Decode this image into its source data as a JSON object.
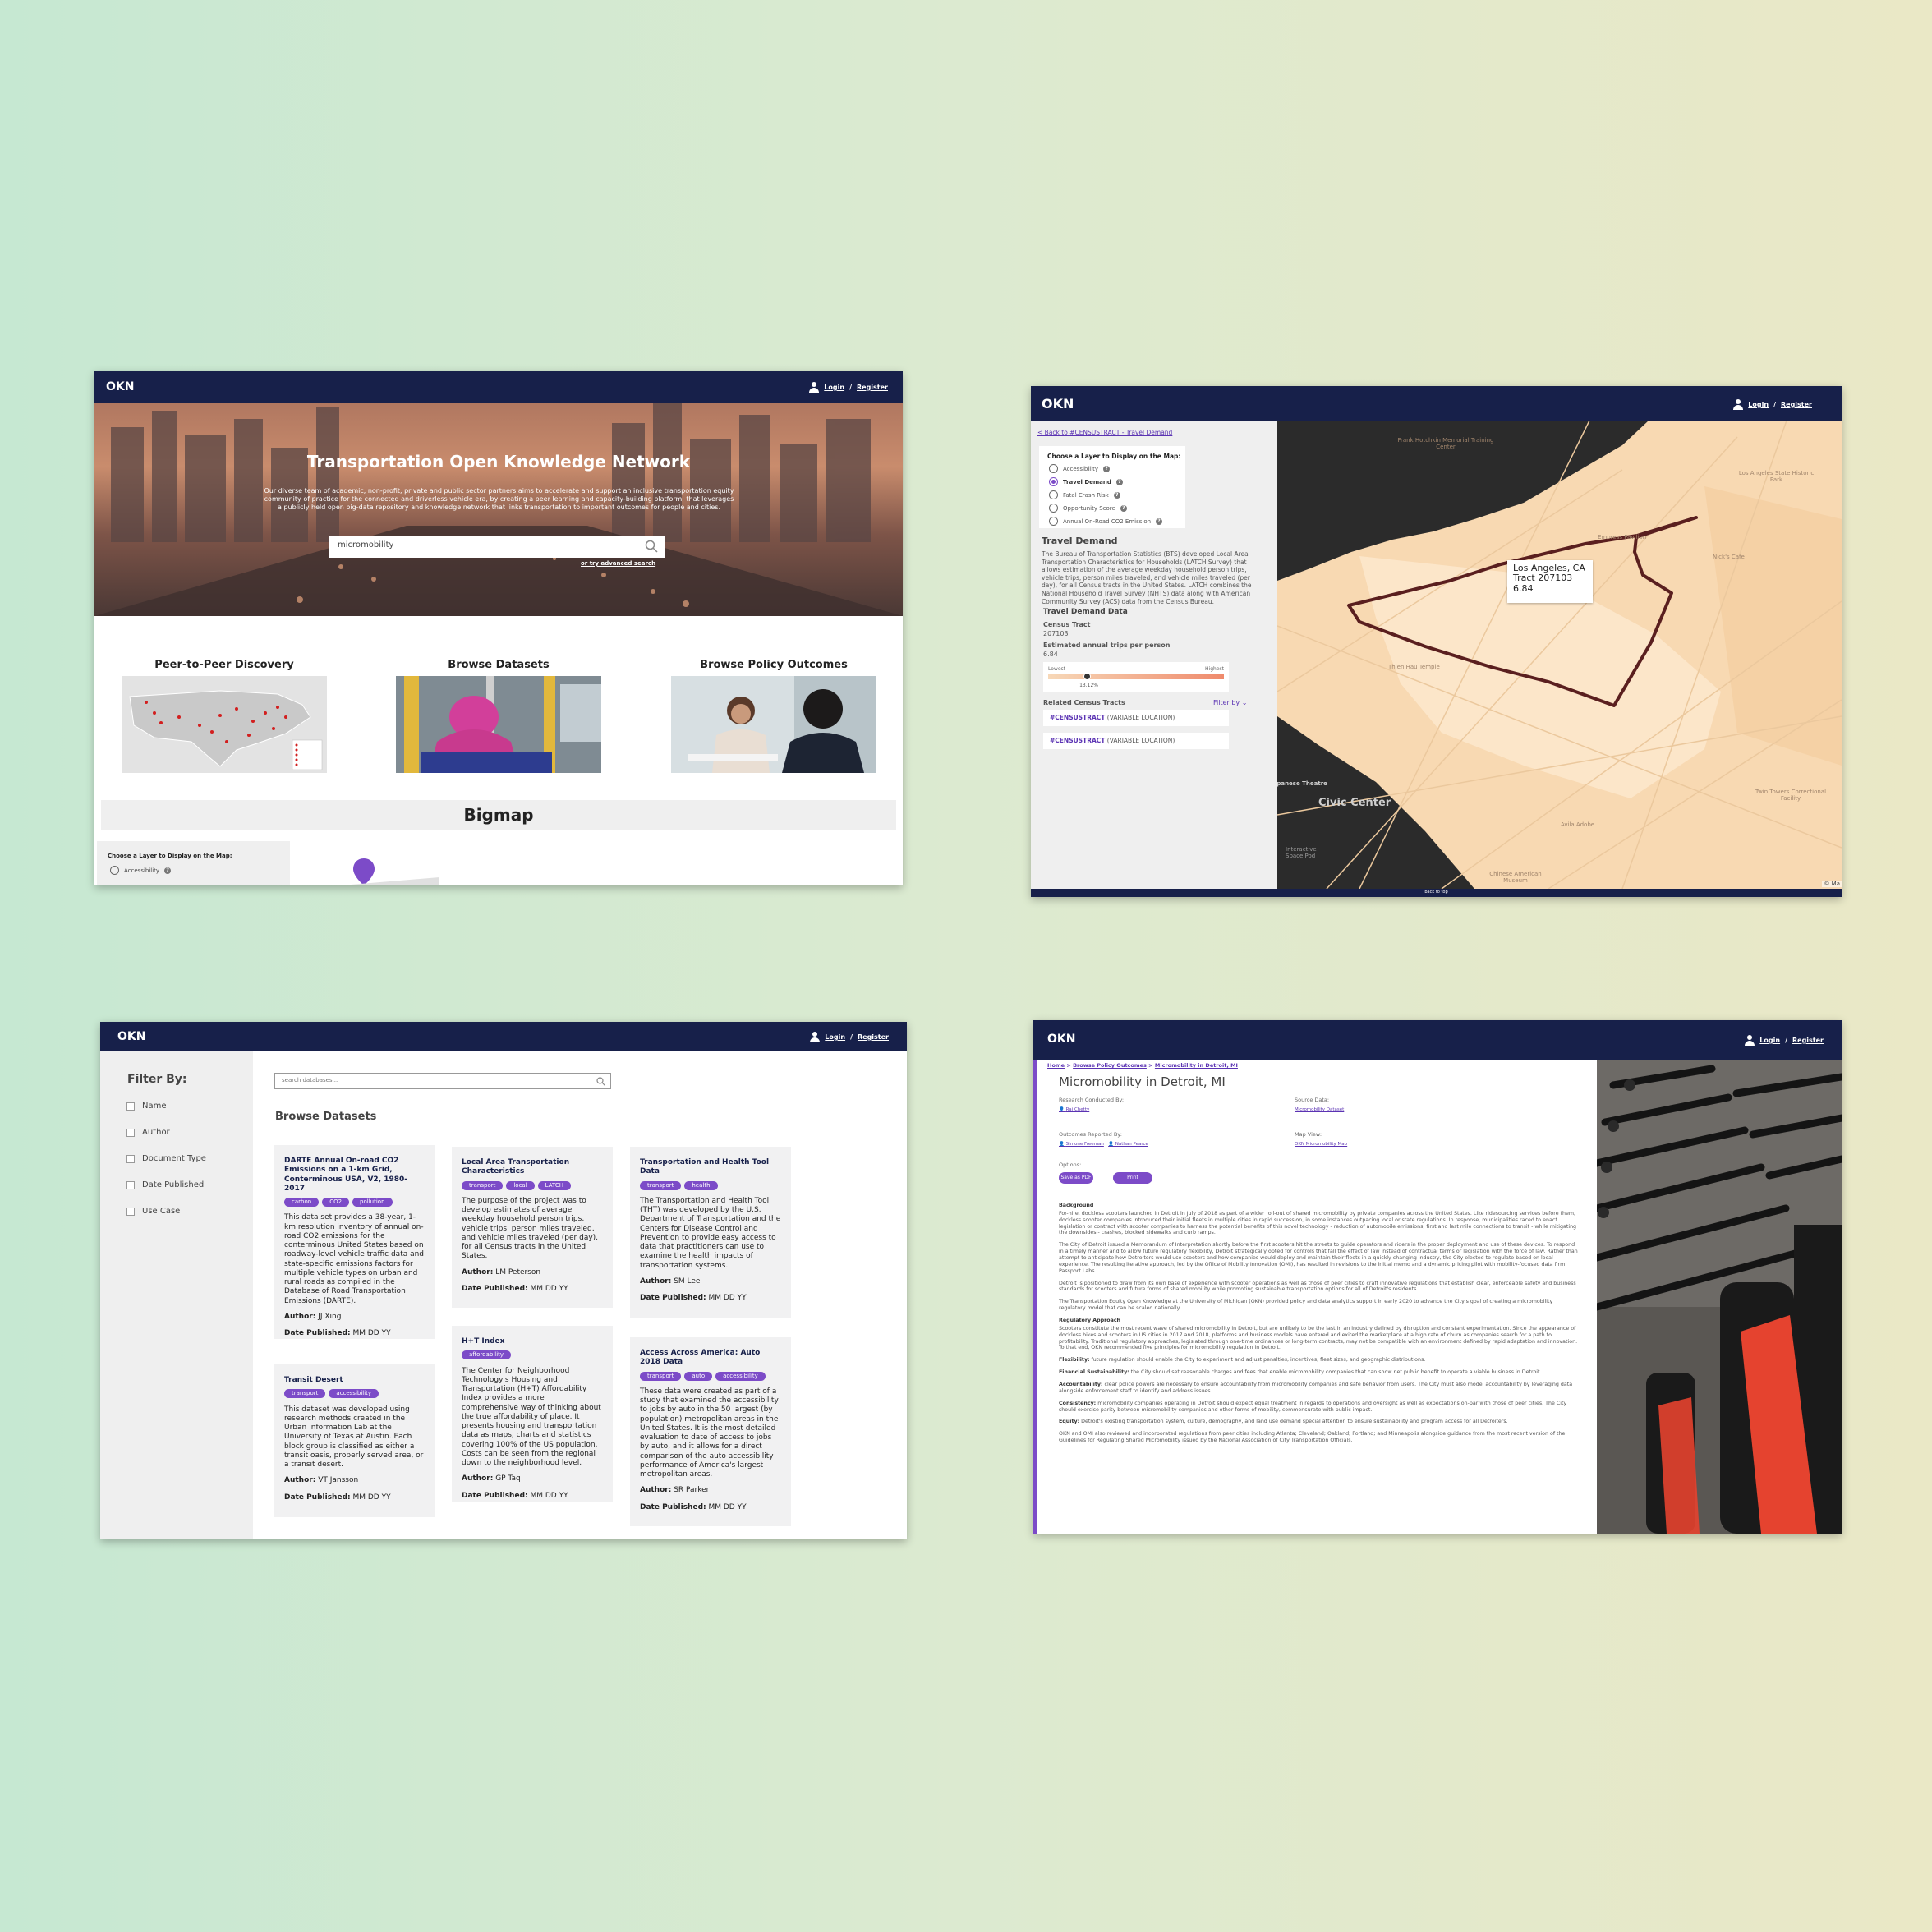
{
  "home": {
    "logo": "OKN",
    "login": "Login",
    "register": "Register",
    "hero_title": "Transportation Open Knowledge Network",
    "hero_text": "Our diverse team of academic, non-profit, private and public sector partners aims to accelerate and support an inclusive transportation equity community of practice for the connected and driverless vehicle era, by creating a peer learning and capacity-building platform, that leverages a publicly held open big-data repository and knowledge network that links transportation to important outcomes for people and cities.",
    "search_value": "micromobility",
    "advanced_search": "or try advanced search",
    "tiles": [
      "Peer-to-Peer Discovery",
      "Browse Datasets",
      "Browse Policy Outcomes"
    ],
    "bigmap_title": "Bigmap",
    "layer_prompt": "Choose a Layer to Display on the Map:",
    "layer_first": "Accessibility"
  },
  "mapview": {
    "logo": "OKN",
    "login": "Login",
    "register": "Register",
    "back_link": "< Back to #CENSUSTRACT - Travel Demand",
    "layer_prompt": "Choose a Layer to Display on the Map:",
    "layers": [
      {
        "label": "Accessibility",
        "selected": false
      },
      {
        "label": "Travel Demand",
        "selected": true
      },
      {
        "label": "Fatal Crash Risk",
        "selected": false
      },
      {
        "label": "Opportunity Score",
        "selected": false
      },
      {
        "label": "Annual On-Road CO2 Emission",
        "selected": false
      }
    ],
    "section_title": "Travel Demand",
    "section_text": "The Bureau of Transportation Statistics (BTS) developed Local Area Transportation Characteristics for Households (LATCH Survey) that allows estimation of the average weekday household person trips, vehicle trips, person miles traveled, and vehicle miles traveled (per day), for all Census tracts in the United States. LATCH combines the National Household Travel Survey (NHTS) data along with American Community Survey (ACS) data from the Census Bureau.",
    "data_title": "Travel Demand Data",
    "census_tract_label": "Census Tract",
    "census_tract_value": "207103",
    "trips_label": "Estimated annual trips per person",
    "trips_value": "6.84",
    "scale_low": "Lowest",
    "scale_high": "Highest",
    "scale_marker": "13.12%",
    "scale_fraction": 0.22,
    "related_title": "Related Census Tracts",
    "filter_by": "Filter by",
    "related": [
      {
        "tag": "#CENSUSTRACT",
        "loc": "(VARIABLE LOCATION)"
      },
      {
        "tag": "#CENSUSTRACT",
        "loc": "(VARIABLE LOCATION)"
      }
    ],
    "tooltip": [
      "Los Angeles, CA",
      "Tract 207103",
      "6.84"
    ],
    "map_labels": [
      "Frank Hotchkin Memorial Training Center",
      "Los Angeles State Historic Park",
      "Empress Pavilion",
      "Nick's Cafe",
      "Thien Hau Temple",
      "Civic Center",
      "Twin Towers Correctional Facility",
      "Avila Adobe",
      "Chinese American Museum",
      "Interactive Space Pod",
      "Japanese Theatre"
    ],
    "map_credit": "© Ma",
    "back_to_top": "back to top"
  },
  "datasets": {
    "logo": "OKN",
    "login": "Login",
    "register": "Register",
    "filter_title": "Filter By:",
    "filters": [
      "Name",
      "Author",
      "Document Type",
      "Date Published",
      "Use Case"
    ],
    "search_placeholder": "search databases...",
    "page_title": "Browse Datasets",
    "author_label": "Author:",
    "date_label": "Date Published:",
    "cards": [
      {
        "title": "DARTE Annual On-road CO2 Emissions on a 1-km Grid, Conterminous USA, V2, 1980-2017",
        "tags": [
          "carbon",
          "CO2",
          "pollution"
        ],
        "desc": "This data set provides a 38-year, 1-km resolution inventory of annual on-road CO2 emissions for the conterminous United States based on roadway-level vehicle traffic data and state-specific emissions factors for multiple vehicle types on urban and rural roads as compiled in the Database of Road Transportation Emissions (DARTE).",
        "author": "JJ Xing",
        "date": "MM DD YY"
      },
      {
        "title": "Local Area Transportation Characteristics",
        "tags": [
          "transport",
          "local",
          "LATCH"
        ],
        "desc": "The purpose of the project was to develop estimates of average weekday household person trips, vehicle trips, person miles traveled, and vehicle miles traveled (per day), for all Census tracts in the United States.",
        "author": "LM Peterson",
        "date": "MM DD YY"
      },
      {
        "title": "Transportation and Health Tool Data",
        "tags": [
          "transport",
          "health"
        ],
        "desc": "The Transportation and Health Tool (THT) was developed by the U.S. Department of Transportation and the Centers for Disease Control and Prevention to provide easy access to data that practitioners can use to examine the health impacts of transportation systems.",
        "author": "SM Lee",
        "date": "MM DD YY"
      },
      {
        "title": "Transit Desert",
        "tags": [
          "transport",
          "accessibility"
        ],
        "desc": "This dataset was developed using research methods created in the Urban Information Lab at the University of Texas at Austin. Each block group is classified as either a transit oasis, properly served area, or a transit desert.",
        "author": "VT Jansson",
        "date": "MM DD YY"
      },
      {
        "title": "H+T Index",
        "tags": [
          "affordability"
        ],
        "desc": "The Center for Neighborhood Technology's Housing and Transportation (H+T) Affordability Index provides a more comprehensive way of thinking about the true affordability of place. It presents housing and transportation data as maps, charts and statistics covering 100% of the US population. Costs can be seen from the regional down to the neighborhood level.",
        "author": "GP Taq",
        "date": "MM DD YY"
      },
      {
        "title": "Access Across America: Auto 2018 Data",
        "tags": [
          "transport",
          "auto",
          "accessibility"
        ],
        "desc": "These data were created as part of a study that examined the accessibility to jobs by auto in the 50 largest (by population) metropolitan areas in the United States. It is the most detailed evaluation to date of access to jobs by auto, and it allows for a direct comparison of the auto accessibility performance of America's largest metropolitan areas.",
        "author": "SR Parker",
        "date": "MM DD YY"
      }
    ]
  },
  "policy": {
    "logo": "OKN",
    "login": "Login",
    "register": "Register",
    "breadcrumb": [
      "Home",
      "Browse Policy Outcomes",
      "Micromobility in Detroit, MI"
    ],
    "title": "Micromobility in Detroit, MI",
    "research_label": "Research Conducted By:",
    "research_person": "Raj Chetty",
    "source_label": "Source Data:",
    "source_value": "Micromobility Dataset",
    "outcomes_label": "Outcomes Reported By:",
    "outcomes_people": [
      "Simone Freeman",
      "Nathan Pearce"
    ],
    "mapview_label": "Map View:",
    "mapview_value": "OKN Micromobility Map",
    "options_label": "Options:",
    "save_pdf": "Save as PDF",
    "print": "Print",
    "background_heading": "Background",
    "paragraphs": [
      "For-hire, dockless scooters launched in Detroit in July of 2018 as part of a wider roll-out of shared micromobility by private companies across the United States. Like ridesourcing services before them, dockless scooter companies introduced their initial fleets in multiple cities in rapid succession, in some instances outpacing local or state regulations. In response, municipalities raced to enact legislation or contract with scooter companies to harness the potential benefits of this novel technology - reduction of automobile emissions, first and last mile connections to transit - while mitigating the downsides - crashes, blocked sidewalks and curb ramps.",
      "The City of Detroit issued a Memorandum of Interpretation shortly before the first scooters hit the streets to guide operators and riders in the proper deployment and use of these devices. To respond in a timely manner and to allow future regulatory flexibility, Detroit strategically opted for controls that fall the effect of law instead of contractual terms or legislation with the force of law. Rather than attempt to anticipate how Detroiters would use scooters and how companies would deploy and maintain their fleets in a quickly changing industry, the City elected to regulate based on local experience. The resulting iterative approach, led by the Office of Mobility Innovation (OMI), has resulted in revisions to the initial memo and a dynamic pricing pilot with mobility-focused data firm Passport Labs.",
      "Detroit is positioned to draw from its own base of experience with scooter operations as well as those of peer cities to craft innovative regulations that establish clear, enforceable safety and business standards for scooters and future forms of shared mobility while promoting sustainable transportation options for all of Detroit's residents.",
      "The Transportation Equity Open Knowledge at the University of Michigan (OKN) provided policy and data analytics support in early 2020 to advance the City's goal of creating a micromobility regulatory model that can be scaled nationally."
    ],
    "approach_heading": "Regulatory Approach",
    "approach_text": "Scooters constitute the most recent wave of shared micromobility in Detroit, but are unlikely to be the last in an industry defined by disruption and constant experimentation. Since the appearance of dockless bikes and scooters in US cities in 2017 and 2018, platforms and business models have entered and exited the marketplace at a high rate of churn as companies search for a path to profitability. Traditional regulatory approaches, legislated through one-time ordinances or long-term contracts, may not be compatible with an environment defined by rapid adaptation and innovation. To that end, OKN recommended five principles for micromobility regulation in Detroit.",
    "principles": [
      {
        "name": "Flexibility:",
        "text": "future regulation should enable the City to experiment and adjust penalties, incentives, fleet sizes, and geographic distributions."
      },
      {
        "name": "Financial Sustainability:",
        "text": "the City should set reasonable charges and fees that enable micromobility companies that can show net public benefit to operate a viable business in Detroit."
      },
      {
        "name": "Accountability:",
        "text": "clear police powers are necessary to ensure accountability from micromobility companies and safe behavior from users. The City must also model accountability by leveraging data alongside enforcement staff to identify and address issues."
      },
      {
        "name": "Consistency:",
        "text": "micromobility companies operating in Detroit should expect equal treatment in regards to operations and oversight as well as expectations on-par with those of peer cities. The City should exercise parity between micromobility companies and other forms of mobility, commensurate with public impact."
      },
      {
        "name": "Equity:",
        "text": "Detroit's existing transportation system, culture, demography, and land use demand special attention to ensure sustainability and program access for all Detroiters."
      }
    ],
    "closing": "OKN and OMI also reviewed and incorporated regulations from peer cities including Atlanta; Cleveland; Oakland; Portland; and Minneapolis alongside guidance from the most recent version of the Guidelines for Regulating Shared Micromobility issued by the National Association of City Transportation Officials."
  },
  "colors": {
    "navy": "#17204a",
    "purple": "#7c4bc8",
    "map_sand": "#f8d9b2",
    "map_dark": "#2b2b2b",
    "tract_outline": "#5a1f1f"
  }
}
